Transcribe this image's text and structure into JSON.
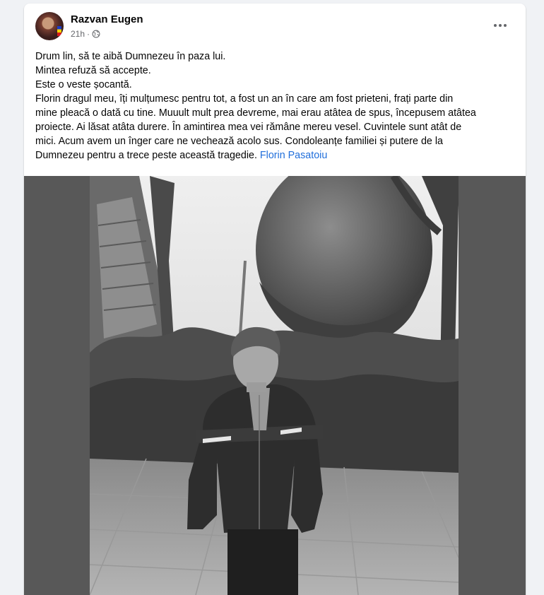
{
  "post": {
    "author": "Razvan Eugen",
    "time": "21h",
    "separator": "·",
    "audience_icon": "globe-icon",
    "more_icon": "more-options-icon",
    "lines": [
      "Drum lin, să te aibă Dumnezeu în paza lui.",
      "Mintea refuză să accepte.",
      "Este o veste șocantă.",
      "Florin dragul meu, îți mulțumesc pentru tot, a fost un an în care am fost prieteni, frați parte din",
      "mine pleacă o dată cu tine. Muuult mult prea devreme, mai erau atâtea de spus, începusem atâtea",
      "proiecte. Ai lăsat atâta durere. În amintirea mea vei rămâne mereu vesel. Cuvintele sunt atât de",
      "mici. Acum avem un înger care ne vechează acolo sus. Condoleanțe familiei și putere de la"
    ],
    "last_line": "Dumnezeu pentru a trece peste această tragedie.",
    "tag": "Florin Pasatoiu",
    "colors": {
      "link": "#216fdb",
      "text": "#050505",
      "meta": "#65676b"
    }
  }
}
